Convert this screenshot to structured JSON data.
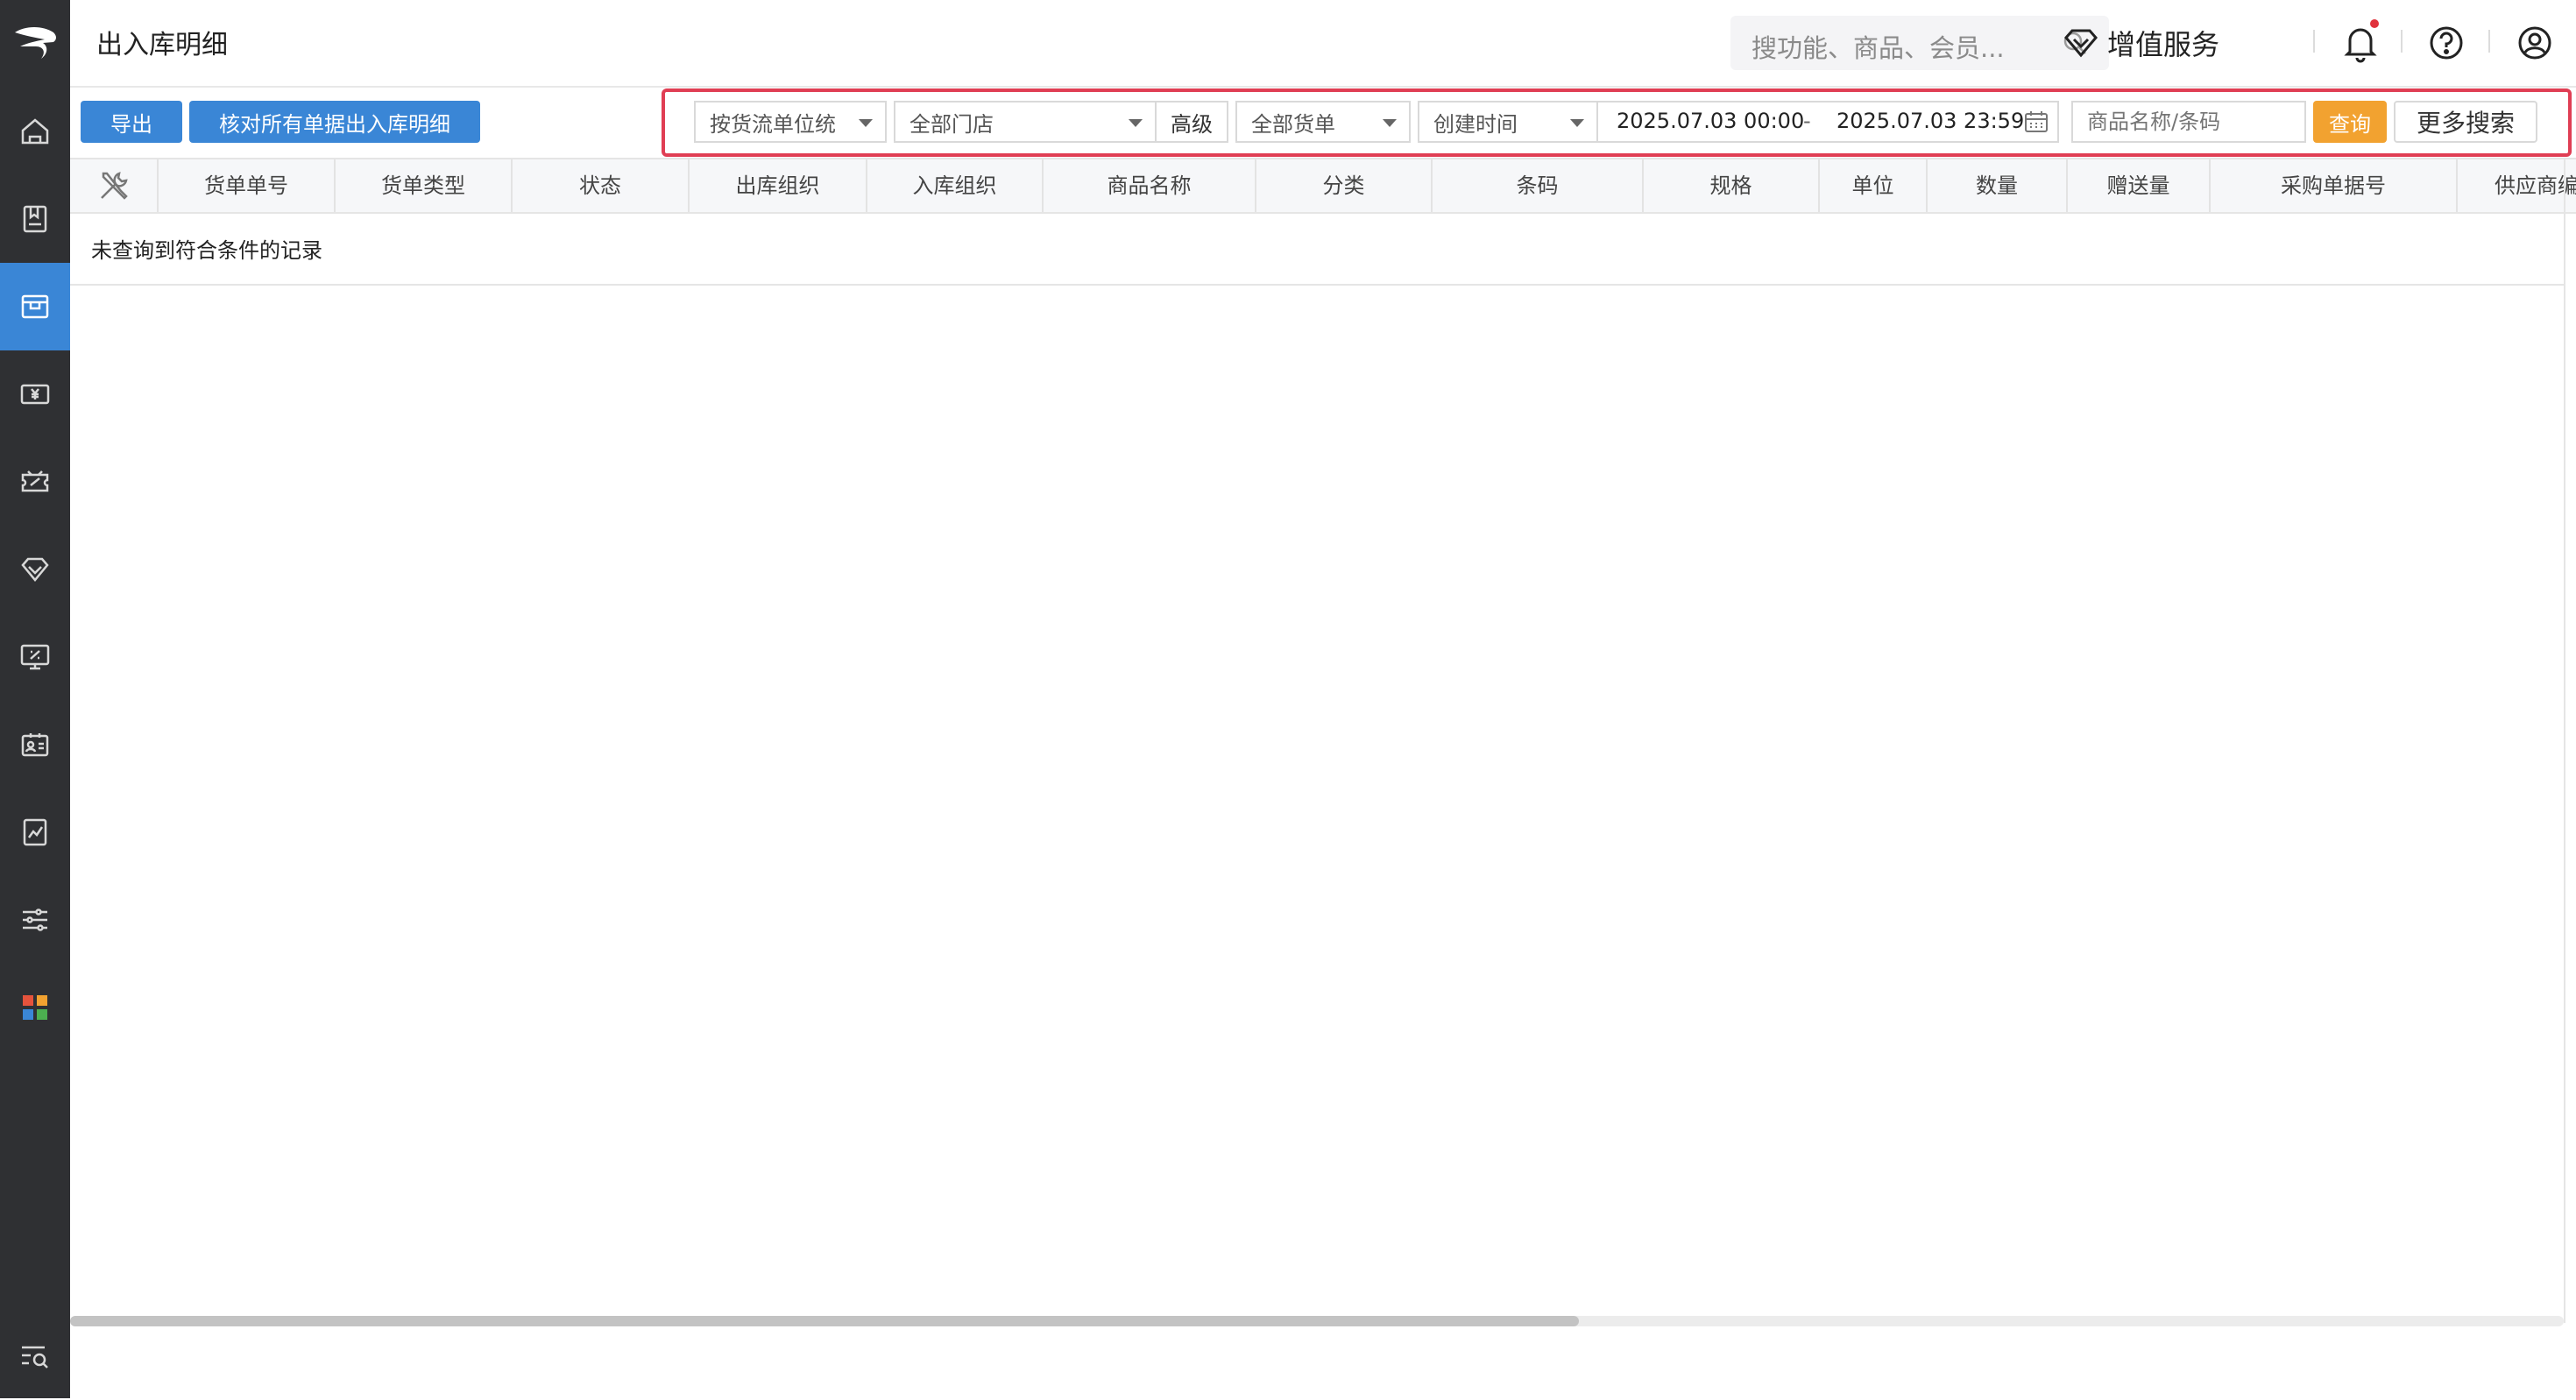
{
  "header": {
    "title": "出入库明细",
    "search_placeholder": "搜功能、商品、会员...",
    "value_added_label": "增值服务"
  },
  "sidebar": {
    "items": [
      {
        "icon": "home-icon"
      },
      {
        "icon": "ledger-icon"
      },
      {
        "icon": "warehouse-icon",
        "active": true
      },
      {
        "icon": "payment-icon"
      },
      {
        "icon": "coupon-icon"
      },
      {
        "icon": "diamond-icon"
      },
      {
        "icon": "monitor-icon"
      },
      {
        "icon": "member-card-icon"
      },
      {
        "icon": "report-icon"
      },
      {
        "icon": "settings-sliders-icon"
      },
      {
        "icon": "apps-grid-icon"
      }
    ],
    "bottom_icon": "search-list-icon",
    "active_color": "#3a86d6"
  },
  "toolbar": {
    "export_label": "导出",
    "reconcile_label": "核对所有单据出入库明细"
  },
  "filters": {
    "stat_by": "按货流单位统",
    "store": "全部门店",
    "advanced_label": "高级",
    "doc_type": "全部货单",
    "time_field": "创建时间",
    "date_start": "2025.07.03 00:00",
    "date_sep": "-",
    "date_end": "2025.07.03 23:59",
    "keyword_placeholder": "商品名称/条码",
    "query_label": "查询",
    "more_label": "更多搜索"
  },
  "table": {
    "columns": [
      "货单单号",
      "货单类型",
      "状态",
      "出库组织",
      "入库组织",
      "商品名称",
      "分类",
      "条码",
      "规格",
      "单位",
      "数量",
      "赠送量",
      "采购单据号",
      "供应商编"
    ],
    "empty_text": "未查询到符合条件的记录"
  },
  "scrollbar": {
    "position_fraction": 0.0,
    "visible_fraction": 0.605
  },
  "colors": {
    "primary": "#3a86d6",
    "query": "#f2a230",
    "highlight_frame": "#e03e54",
    "notification_dot": "#e0323c"
  }
}
